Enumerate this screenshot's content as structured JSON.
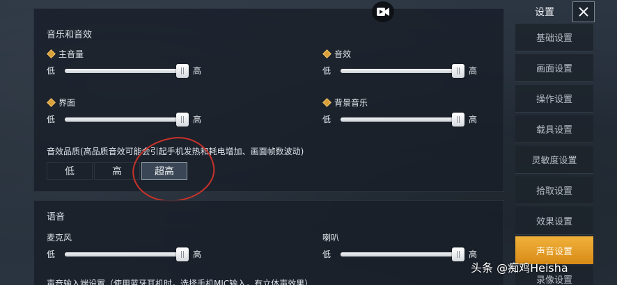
{
  "sidebar": {
    "title": "设置",
    "items": [
      {
        "label": "基础设置"
      },
      {
        "label": "画面设置"
      },
      {
        "label": "操作设置"
      },
      {
        "label": "载具设置"
      },
      {
        "label": "灵敏度设置"
      },
      {
        "label": "拾取设置"
      },
      {
        "label": "效果设置"
      },
      {
        "label": "声音设置",
        "active": true
      },
      {
        "label": "录像设置"
      }
    ]
  },
  "sound": {
    "title": "音乐和音效",
    "sliders": [
      {
        "label": "主音量",
        "low": "低",
        "high": "高",
        "value_percent": 100
      },
      {
        "label": "音效",
        "low": "低",
        "high": "高",
        "value_percent": 100
      },
      {
        "label": "界面",
        "low": "低",
        "high": "高",
        "value_percent": 100
      },
      {
        "label": "背景音乐",
        "low": "低",
        "high": "高",
        "value_percent": 100
      }
    ],
    "quality": {
      "description": "音效品质(高品质音效可能会引起手机发热和耗电增加、画面帧数波动)",
      "options": [
        "低",
        "高",
        "超高"
      ],
      "selected": "超高"
    }
  },
  "voice": {
    "title": "语音",
    "sliders": [
      {
        "label": "麦克风",
        "low": "低",
        "high": "高",
        "value_percent": 100
      },
      {
        "label": "喇叭",
        "low": "低",
        "high": "高",
        "value_percent": 100
      }
    ],
    "input_desc": "声音输入端设置（使用蓝牙耳机时，选择手机MIC输入，有立体声效果）"
  },
  "watermark": "头条 @痴鸡Heisha",
  "colors": {
    "accent": "#e7a22b",
    "annotation": "#c9322a"
  },
  "icons": {
    "close": "close-icon",
    "record": "video-camera-icon",
    "item_marker": "diamond-icon"
  }
}
